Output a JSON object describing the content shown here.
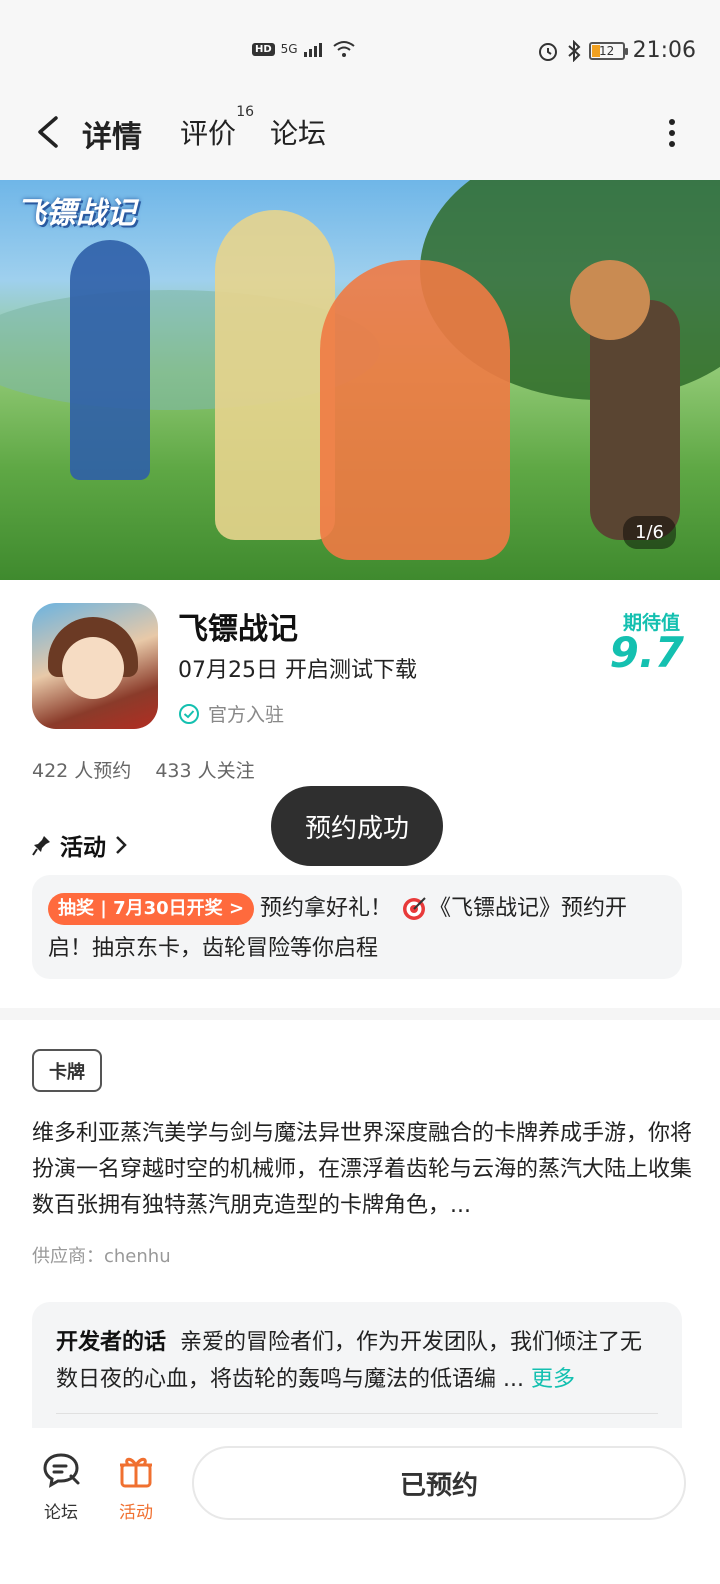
{
  "status_bar": {
    "hd": "HD",
    "network": "5G",
    "battery": "12",
    "time": "21:06"
  },
  "nav": {
    "tabs": [
      {
        "label": "详情",
        "active": true
      },
      {
        "label": "评价",
        "badge": "16"
      },
      {
        "label": "论坛"
      }
    ]
  },
  "banner": {
    "logo_text": "飞镖战记",
    "page_indicator": "1/6"
  },
  "game": {
    "title": "飞镖战记",
    "subtitle": "07月25日 开启测试下载",
    "official_label": "官方入驻",
    "expect_label": "期待值",
    "expect_score": "9.7",
    "stats": [
      "422 人预约",
      "433 人关注"
    ]
  },
  "toast": {
    "text": "预约成功"
  },
  "activity": {
    "header": "活动",
    "tag": "抽奖 | 7月30日开奖 >",
    "text_before": "预约拿好礼！",
    "text_after": "《飞镖战记》预约开启！抽京东卡，齿轮冒险等你启程"
  },
  "description": {
    "genre": "卡牌",
    "text": "维多利亚蒸汽美学与剑与魔法异世界深度融合的卡牌养成手游，你将扮演一名穿越时空的机械师，在漂浮着齿轮与云海的蒸汽大陆上收集数百张拥有独特蒸汽朋克造型的卡牌角色，...",
    "supplier": "供应商：chenhu"
  },
  "developer": {
    "label": "开发者的话",
    "text": "亲爱的冒险者们，作为开发团队，我们倾注了无数日夜的心血，将齿轮的轰鸣与魔法的低语编 ...",
    "more": "更多"
  },
  "bottom_bar": {
    "forum_label": "论坛",
    "activity_label": "活动",
    "reserved_label": "已预约"
  },
  "colors": {
    "accent": "#14c0b0",
    "orange": "#f07030",
    "lottery_tag": "#ff6a3d",
    "toast_bg": "#2f2f2f"
  },
  "icons": [
    "back-arrow-icon",
    "more-vertical-icon",
    "check-circle-icon",
    "pin-icon",
    "chevron-right-icon",
    "target-icon",
    "forum-chat-icon",
    "gift-icon"
  ]
}
